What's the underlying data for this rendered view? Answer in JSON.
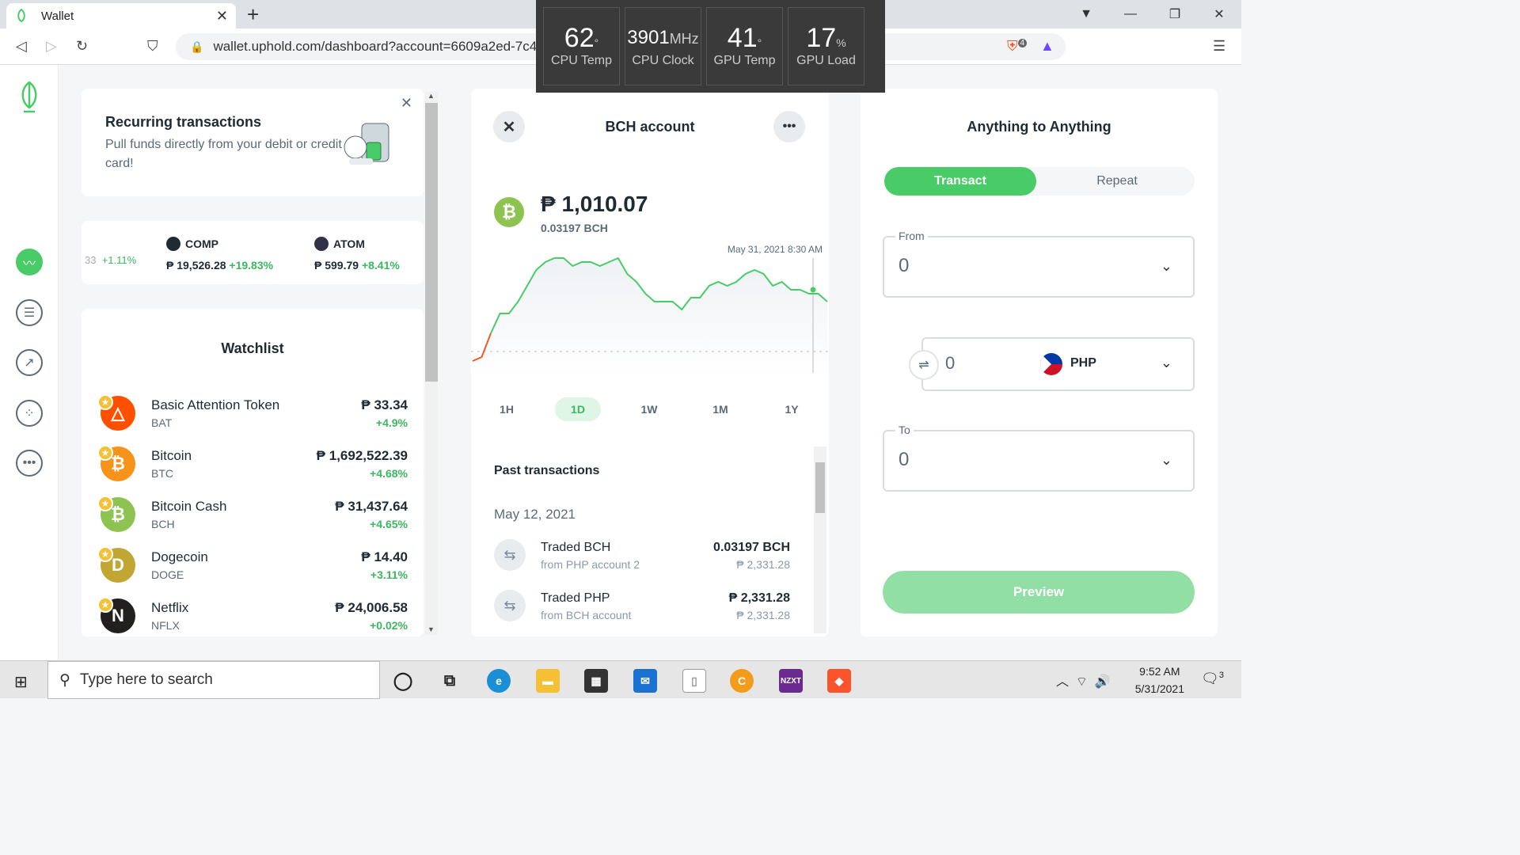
{
  "browser": {
    "tab_title": "Wallet",
    "url": "wallet.uphold.com/dashboard?account=6609a2ed-7c40-48d…9a3-9883/8e6056",
    "brave_badge": "4"
  },
  "hud": [
    {
      "value": "62",
      "unit": "°",
      "label": "CPU Temp"
    },
    {
      "value": "3901",
      "unit": "MHz",
      "label": "CPU Clock"
    },
    {
      "value": "41",
      "unit": "°",
      "label": "GPU Temp"
    },
    {
      "value": "17",
      "unit": "%",
      "label": "GPU Load"
    }
  ],
  "recurring": {
    "title": "Recurring transactions",
    "body": "Pull funds directly from your debit or credit card!"
  },
  "ticker": [
    {
      "name": "",
      "price": "33",
      "change": "+1.11%"
    },
    {
      "name": "COMP",
      "price": "₱ 19,526.28",
      "change": "+19.83%"
    },
    {
      "name": "ATOM",
      "price": "₱ 599.79",
      "change": "+8.41%"
    }
  ],
  "watchlist": {
    "title": "Watchlist",
    "items": [
      {
        "name": "Basic Attention Token",
        "symbol": "BAT",
        "price": "₱ 33.34",
        "change": "+4.9%",
        "color": "#ff5000",
        "glyph": "△"
      },
      {
        "name": "Bitcoin",
        "symbol": "BTC",
        "price": "₱ 1,692,522.39",
        "change": "+4.68%",
        "color": "#f7931a",
        "glyph": "₿"
      },
      {
        "name": "Bitcoin Cash",
        "symbol": "BCH",
        "price": "₱ 31,437.64",
        "change": "+4.65%",
        "color": "#8dc351",
        "glyph": "₿"
      },
      {
        "name": "Dogecoin",
        "symbol": "DOGE",
        "price": "₱ 14.40",
        "change": "+3.11%",
        "color": "#c2a633",
        "glyph": "D"
      },
      {
        "name": "Netflix",
        "symbol": "NFLX",
        "price": "₱ 24,006.58",
        "change": "+0.02%",
        "color": "#221f1f",
        "glyph": "N"
      }
    ]
  },
  "account": {
    "title": "BCH account",
    "balance": "₱ 1,010.07",
    "crypto_balance": "0.03197 BCH",
    "chart_timestamp": "May 31, 2021 8:30 AM",
    "ranges": [
      "1H",
      "1D",
      "1W",
      "1M",
      "1Y"
    ],
    "active_range": "1D",
    "past_title": "Past transactions",
    "date": "May 12, 2021",
    "transactions": [
      {
        "title": "Traded BCH",
        "sub": "from PHP account 2",
        "amount": "0.03197 BCH",
        "sub_amount": "₱ 2,331.28"
      },
      {
        "title": "Traded PHP",
        "sub": "from BCH account",
        "amount": "₱ 2,331.28",
        "sub_amount": "₱ 2,331.28"
      }
    ]
  },
  "chart_data": {
    "type": "line",
    "x": [
      0,
      1,
      2,
      3,
      4,
      5,
      6,
      7,
      8,
      9,
      10,
      11,
      12,
      13,
      14,
      15,
      16,
      17,
      18,
      19,
      20,
      21,
      22,
      23,
      24,
      25,
      26,
      27,
      28,
      29,
      30,
      31,
      32,
      33,
      34,
      35,
      36,
      37,
      38,
      39
    ],
    "y": [
      0,
      2,
      14,
      24,
      24,
      30,
      38,
      46,
      50,
      52,
      52,
      48,
      50,
      50,
      48,
      50,
      52,
      44,
      40,
      34,
      30,
      30,
      30,
      26,
      32,
      32,
      38,
      40,
      38,
      40,
      44,
      46,
      44,
      38,
      40,
      36,
      36,
      34,
      34,
      30
    ],
    "title": "",
    "xlabel": "",
    "ylabel": ""
  },
  "convert": {
    "title": "Anything to Anything",
    "tab_active": "Transact",
    "tab_other": "Repeat",
    "from_label": "From",
    "from_value": "0",
    "mid_value": "0",
    "currency": "PHP",
    "to_label": "To",
    "to_value": "0",
    "preview": "Preview"
  },
  "taskbar": {
    "search_placeholder": "Type here to search",
    "time": "9:52 AM",
    "date": "5/31/2021",
    "notif_count": "3"
  }
}
